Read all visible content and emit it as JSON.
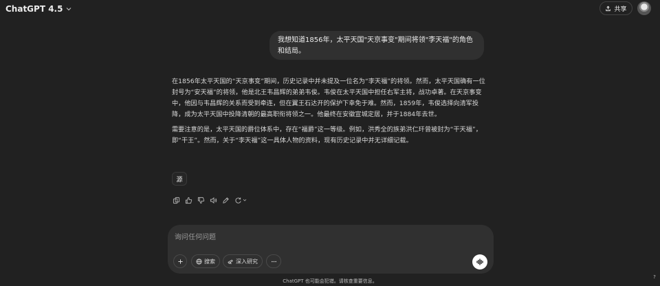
{
  "header": {
    "model_name": "ChatGPT 4.5",
    "share_label": "共享"
  },
  "conversation": {
    "user_message": "我想知道1856年，太平天国\"天京事变\"期间将领\"李天福\"的角色和结局。",
    "assistant_paragraphs": [
      "在1856年太平天国的“天京事变”期间，历史记录中并未提及一位名为“李天福”的将领。然而，太平天国确有一位封号为“安天福”的将领，他是北王韦昌辉的弟弟韦俊。韦俊在太平天国中担任右军主将，战功卓著。在天京事变中，他因与韦昌辉的关系而受到牵连，但在翼王石达开的保护下幸免于难。然而，1859年，韦俊选择向清军投降，成为太平天国中投降清朝的最高职衔将领之一。他最终在安徽宣城定居，并于1884年去世。",
      "需要注意的是，太平天国的爵位体系中，存在“福爵”这一等级。例如，洪秀全的族弟洪仁玕曾被封为“干天福”，即“干王”。然而，关于“李天福”这一具体人物的资料，现有历史记录中并无详细记载。"
    ],
    "source_label": "源"
  },
  "composer": {
    "placeholder": "询问任何问题",
    "search_label": "搜索",
    "research_label": "深入研究"
  },
  "footer": {
    "disclaimer": "ChatGPT 也可能会犯错。请核查重要信息。",
    "help": "?"
  }
}
